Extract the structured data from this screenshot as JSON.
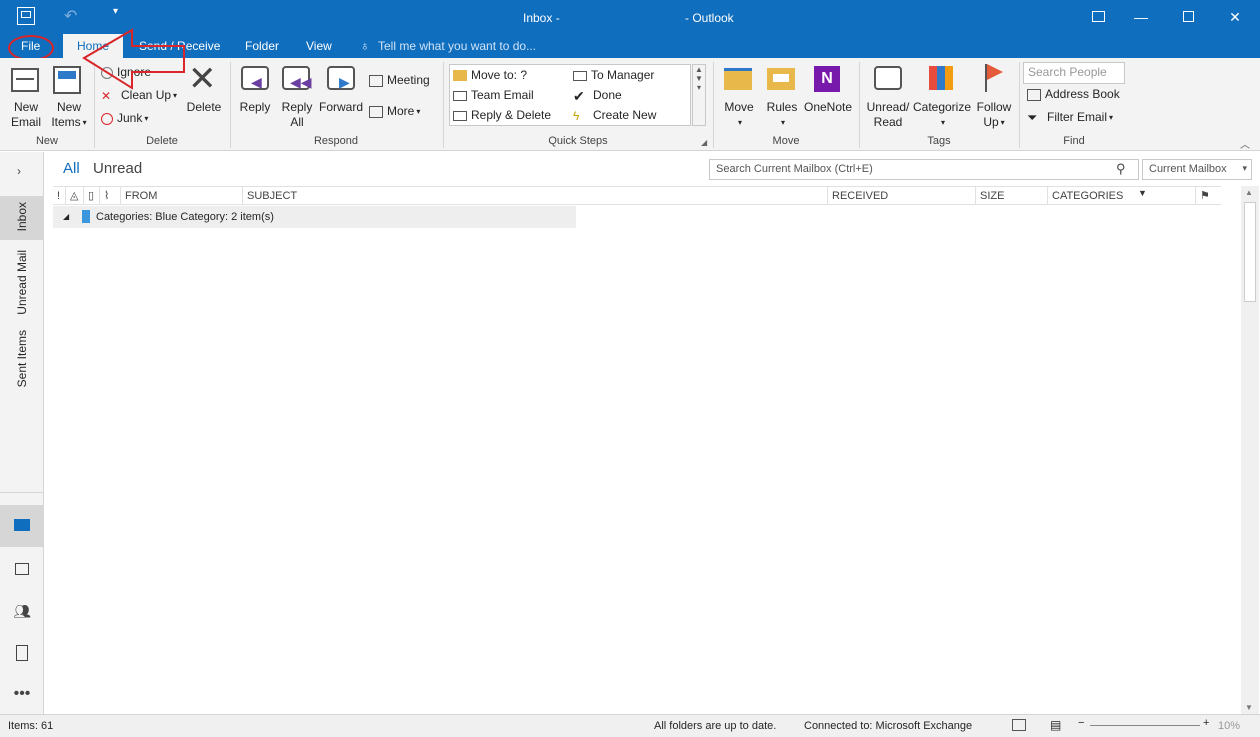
{
  "title_bar": {
    "title": "Inbox -",
    "app": "- Outlook"
  },
  "tabs": [
    {
      "label": "File"
    },
    {
      "label": "Home"
    },
    {
      "label": "Send / Receive"
    },
    {
      "label": "Folder"
    },
    {
      "label": "View"
    }
  ],
  "tell_me": "Tell me what you want to do...",
  "ribbon": {
    "new": {
      "new_email": [
        "New",
        "Email"
      ],
      "new_items": [
        "New",
        "Items"
      ],
      "group": "New"
    },
    "delete": {
      "ignore": "Ignore",
      "clean_up": "Clean Up",
      "junk": "Junk",
      "delete": "Delete",
      "group": "Delete"
    },
    "respond": {
      "reply": "Reply",
      "reply_all": [
        "Reply",
        "All"
      ],
      "forward": "Forward",
      "meeting": "Meeting",
      "more": "More",
      "group": "Respond"
    },
    "quick_steps": {
      "items": [
        "Move to: ?",
        "Team Email",
        "Reply & Delete",
        "To Manager",
        "Done",
        "Create New"
      ],
      "group": "Quick Steps"
    },
    "move": {
      "move": "Move",
      "rules": "Rules",
      "onenote": "OneNote",
      "group": "Move"
    },
    "tags": {
      "unread_read": [
        "Unread/",
        "Read"
      ],
      "categorize": "Categorize",
      "follow_up": [
        "Follow",
        "Up"
      ],
      "group": "Tags"
    },
    "find": {
      "search_people_placeholder": "Search People",
      "address_book": "Address Book",
      "filter_email": "Filter Email",
      "group": "Find"
    }
  },
  "left_pane": {
    "folders": [
      "Inbox",
      "Unread Mail",
      "Sent Items"
    ]
  },
  "mail_list": {
    "filters": {
      "all": "All",
      "unread": "Unread"
    },
    "search_placeholder": "Search Current Mailbox (Ctrl+E)",
    "scope": "Current Mailbox",
    "columns": {
      "from": "FROM",
      "subject": "SUBJECT",
      "received": "RECEIVED",
      "size": "SIZE",
      "categories": "CATEGORIES"
    },
    "group_header": "Categories: Blue Category: 2 item(s)"
  },
  "status_bar": {
    "items": "Items: 61",
    "sync": "All folders are up to date.",
    "connection": "Connected to: Microsoft Exchange",
    "zoom": "10%"
  },
  "colors": {
    "accent": "#106ebe",
    "annotation": "#d9262b",
    "blue_category": "#3a96dd"
  }
}
